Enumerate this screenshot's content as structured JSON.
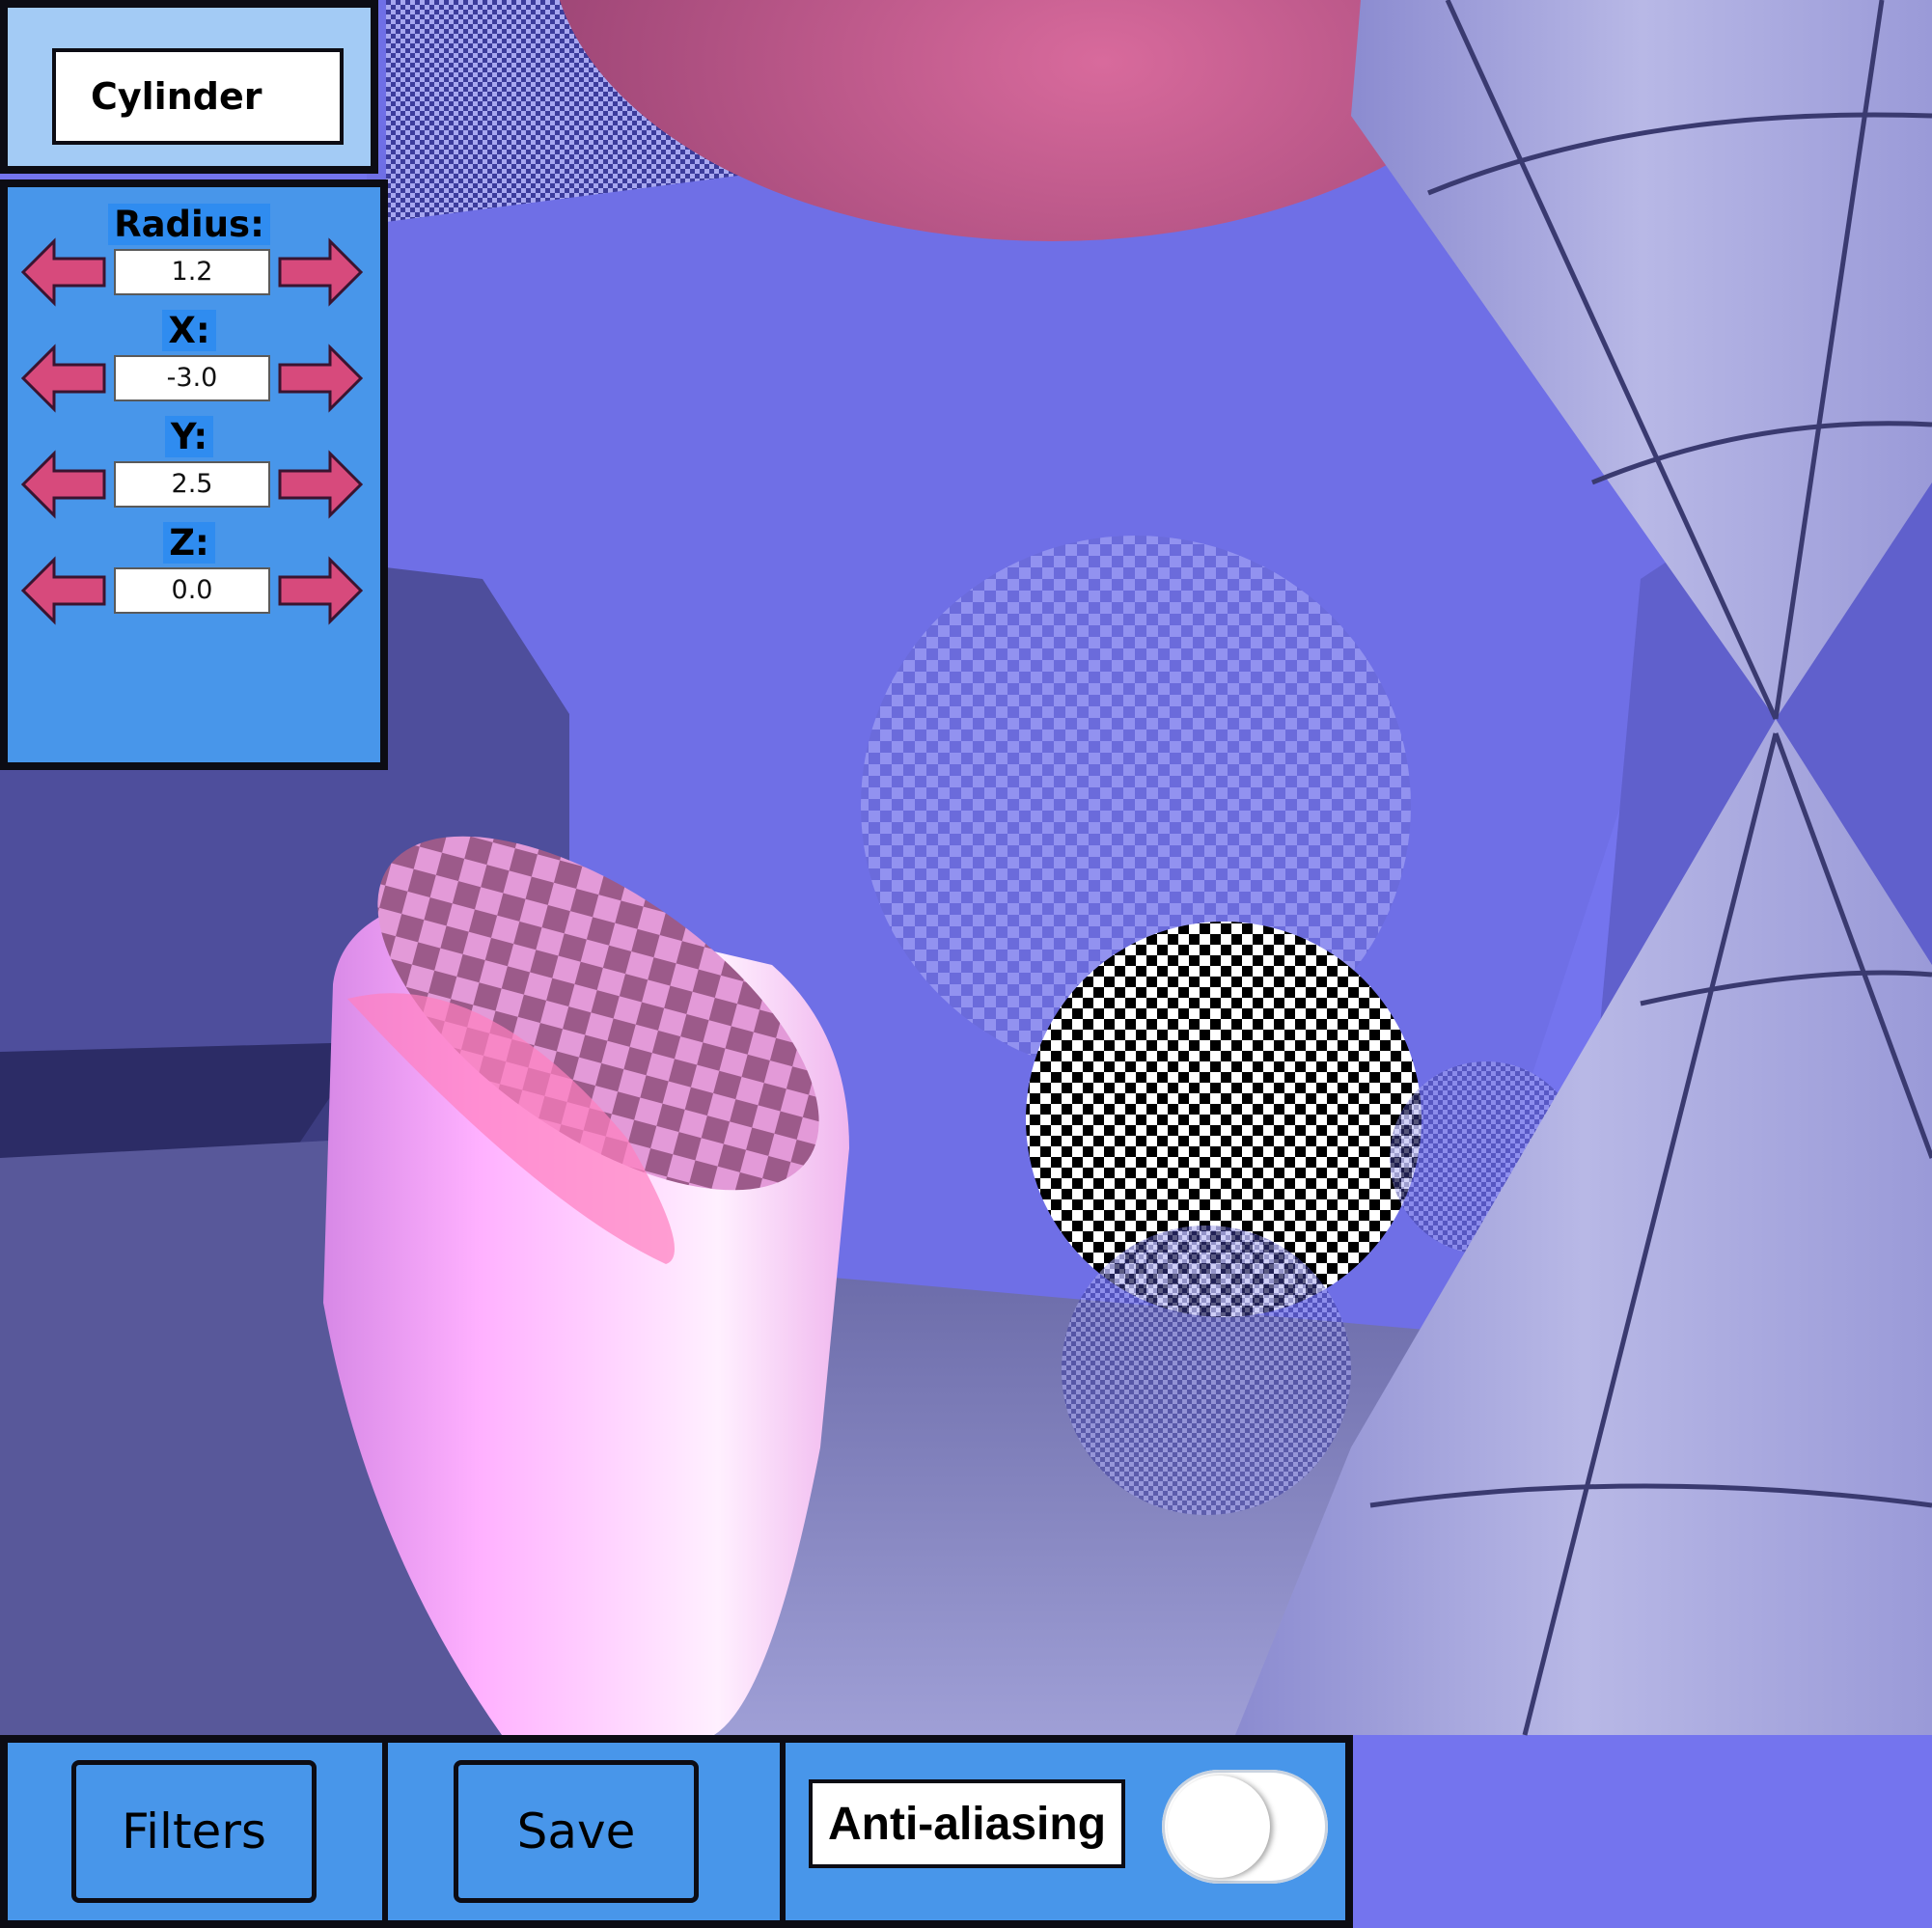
{
  "object_panel": {
    "object_name": "Cylinder"
  },
  "params": [
    {
      "label": "Radius:",
      "value": "1.2"
    },
    {
      "label": "X:",
      "value": "-3.0"
    },
    {
      "label": "Y:",
      "value": "2.5"
    },
    {
      "label": "Z:",
      "value": "0.0"
    }
  ],
  "toolbar": {
    "filters_label": "Filters",
    "save_label": "Save",
    "antialias_label": "Anti-aliasing",
    "antialias_enabled": false
  },
  "colors": {
    "panel_blue": "#4896ea",
    "panel_light_blue": "#a3cbf5",
    "arrow_pink": "#d74a7c",
    "border": "#0c0c14"
  }
}
